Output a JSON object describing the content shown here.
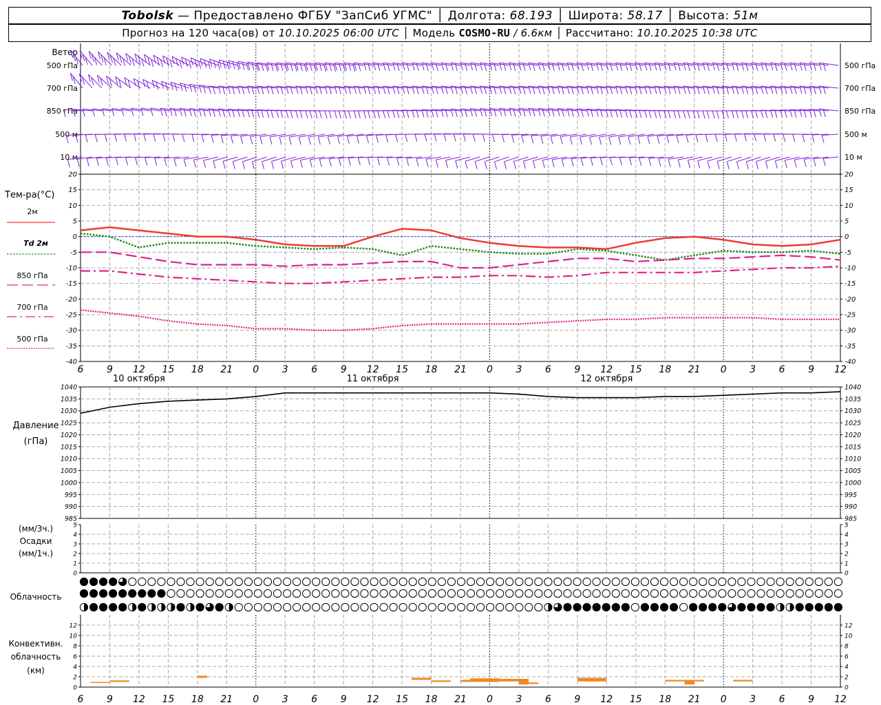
{
  "header": {
    "station": "Tobolsk",
    "dash": "—",
    "provider": "Предоставлено ФГБУ \"ЗапСиб УГМС\"",
    "lon_label": "Долгота:",
    "lon_value": "68.193",
    "lat_label": "Широта:",
    "lat_value": "58.17",
    "alt_label": "Высота:",
    "alt_value": "51м",
    "forecast_label": "Прогноз на 120 часа(ов) от",
    "forecast_start": "10.10.2025 06:00 UTC",
    "model_label": "Модель",
    "model_name": "COSMO-RU",
    "model_res": "/ 6.6км",
    "calc_label": "Рассчитано:",
    "calc_time": "10.10.2025 10:38 UTC"
  },
  "wind_panel": {
    "title": "Ветер",
    "levels": [
      "500 гПа",
      "700 гПа",
      "850 гПа",
      "500 м",
      "10  м"
    ],
    "barb_color": "#7a1fd6"
  },
  "chart_data": [
    {
      "type": "line",
      "panel": "temperature",
      "title": "Тем-ра(°C)",
      "ylim": [
        -40,
        20
      ],
      "yticks": [
        20,
        15,
        10,
        5,
        0,
        -5,
        -10,
        -15,
        -20,
        -25,
        -30,
        -35,
        -40
      ],
      "x_hours": [
        0,
        3,
        6,
        9,
        12,
        15,
        18,
        21,
        24,
        27,
        30,
        33,
        36,
        39,
        42,
        45,
        48,
        51,
        54,
        57,
        60,
        63,
        66,
        69,
        72,
        75,
        78
      ],
      "x_ticks": [
        "6",
        "9",
        "12",
        "15",
        "18",
        "21",
        "0",
        "3",
        "6",
        "9",
        "12",
        "15",
        "18",
        "21",
        "0",
        "3",
        "6",
        "9",
        "12",
        "15",
        "18",
        "21",
        "0",
        "3",
        "6",
        "9",
        "12"
      ],
      "dates": [
        {
          "label": "10 октября",
          "hour": 6
        },
        {
          "label": "11 октября",
          "hour": 30
        },
        {
          "label": "12 октября",
          "hour": 54
        }
      ],
      "series": [
        {
          "name": "2м",
          "color": "#f03a2e",
          "style": "solid",
          "values": [
            2,
            3,
            2,
            1,
            0,
            0,
            -1,
            -2.5,
            -3,
            -3,
            0,
            2.5,
            2,
            -0.5,
            -2,
            -3,
            -3.5,
            -3.5,
            -4,
            -2,
            -0.5,
            0,
            -1,
            -2.5,
            -3,
            -2.5,
            -1
          ]
        },
        {
          "name": "Td  2м",
          "color": "#1a8a1a",
          "style": "dotted",
          "values": [
            1,
            0,
            -3.5,
            -2,
            -2,
            -2,
            -3,
            -3.5,
            -4,
            -3.5,
            -4,
            -6,
            -3,
            -4,
            -5,
            -5.5,
            -5.5,
            -4,
            -4.5,
            -6,
            -7.5,
            -6,
            -4.5,
            -5,
            -5,
            -4.5,
            -5.5
          ]
        },
        {
          "name": "850 гПа",
          "color": "#e0208c",
          "style": "longdash",
          "values": [
            -5,
            -5,
            -6.5,
            -8,
            -9,
            -9,
            -9,
            -9.5,
            -9,
            -9,
            -8.5,
            -8,
            -8,
            -10,
            -10,
            -9,
            -8,
            -7,
            -7,
            -8,
            -7.5,
            -7,
            -7,
            -6.5,
            -6,
            -6.5,
            -7.5
          ]
        },
        {
          "name": "700 гПа",
          "color": "#e0208c",
          "style": "dashdot",
          "values": [
            -11,
            -11,
            -12,
            -13,
            -13.5,
            -14,
            -14.5,
            -15,
            -15,
            -14.5,
            -14,
            -13.5,
            -13,
            -13,
            -12.5,
            -12.5,
            -13,
            -12.5,
            -11.5,
            -11.5,
            -11.5,
            -11.5,
            -11,
            -10.5,
            -10,
            -10,
            -9.5
          ]
        },
        {
          "name": "500 гПа",
          "color": "#e0208c",
          "style": "dotdense",
          "values": [
            -23.5,
            -24.5,
            -25.5,
            -27,
            -28,
            -28.5,
            -29.5,
            -29.5,
            -30,
            -30,
            -29.5,
            -28.5,
            -28,
            -28,
            -28,
            -28,
            -27.5,
            -27,
            -26.5,
            -26.5,
            -26,
            -26,
            -26,
            -26,
            -26.5,
            -26.5,
            -26.5
          ]
        }
      ]
    },
    {
      "type": "line",
      "panel": "pressure",
      "title": "Давление",
      "unit": "(гПа)",
      "ylim": [
        985,
        1040
      ],
      "yticks": [
        1040,
        1035,
        1030,
        1025,
        1020,
        1015,
        1010,
        1005,
        1000,
        995,
        990,
        985
      ],
      "series": [
        {
          "color": "#000000",
          "values": [
            1029,
            1031.5,
            1033,
            1034,
            1034.5,
            1035,
            1036,
            1037.5,
            1037.5,
            1037.5,
            1037.5,
            1037.5,
            1037.5,
            1037.5,
            1037.5,
            1037,
            1036,
            1035.5,
            1035.5,
            1035.5,
            1036,
            1036,
            1036.5,
            1037,
            1037.5,
            1037.5,
            1038
          ]
        }
      ]
    },
    {
      "type": "bar",
      "panel": "precipitation",
      "labels": [
        "(мм/3ч.)",
        "Осадки",
        "(мм/1ч.)"
      ],
      "ylim": [
        0,
        5
      ],
      "yticks": [
        5,
        4,
        3,
        2,
        1,
        0
      ],
      "values": []
    },
    {
      "type": "table",
      "panel": "cloudiness",
      "title": "Облачность",
      "rows_octas_hourly": {
        "high": "4444311111111111111111111111111111111111111111111111111111111111111111111111111",
        "mid": "4444444441111111111111111111111111111111111111111111111111111111111111111111111",
        "low": "2444424222424342111111111111111111111111111111112344444441444414444344442244444444444444444444444444444444"
      }
    },
    {
      "type": "bar",
      "panel": "convective_cloud",
      "labels": [
        "Конвективн.",
        "облачность",
        "(км)"
      ],
      "ylim": [
        0,
        14
      ],
      "yticks": [
        12,
        10,
        8,
        6,
        4,
        2,
        0
      ],
      "color": "#f08a24",
      "segments": [
        {
          "from": 1,
          "to": 3,
          "bottom": 1,
          "top": 1
        },
        {
          "from": 3,
          "to": 5,
          "bottom": 1,
          "top": 1.3
        },
        {
          "from": 12,
          "to": 13,
          "bottom": 1.8,
          "top": 2.2
        },
        {
          "from": 34,
          "to": 36,
          "bottom": 1.4,
          "top": 1.8
        },
        {
          "from": 36,
          "to": 38,
          "bottom": 1,
          "top": 1.3
        },
        {
          "from": 39,
          "to": 40,
          "bottom": 1,
          "top": 1.4
        },
        {
          "from": 40,
          "to": 43,
          "bottom": 1,
          "top": 1.7
        },
        {
          "from": 43,
          "to": 45,
          "bottom": 1.1,
          "top": 1.6
        },
        {
          "from": 45,
          "to": 46,
          "bottom": 0.5,
          "top": 1.6
        },
        {
          "from": 46,
          "to": 47,
          "bottom": 0.6,
          "top": 0.9
        },
        {
          "from": 51,
          "to": 54,
          "bottom": 1.1,
          "top": 1.8
        },
        {
          "from": 60,
          "to": 62,
          "bottom": 1.1,
          "top": 1.4
        },
        {
          "from": 62,
          "to": 63,
          "bottom": 0.5,
          "top": 1.4
        },
        {
          "from": 63,
          "to": 64,
          "bottom": 1.1,
          "top": 1.4
        },
        {
          "from": 67,
          "to": 69,
          "bottom": 1.1,
          "top": 1.4
        }
      ]
    }
  ]
}
